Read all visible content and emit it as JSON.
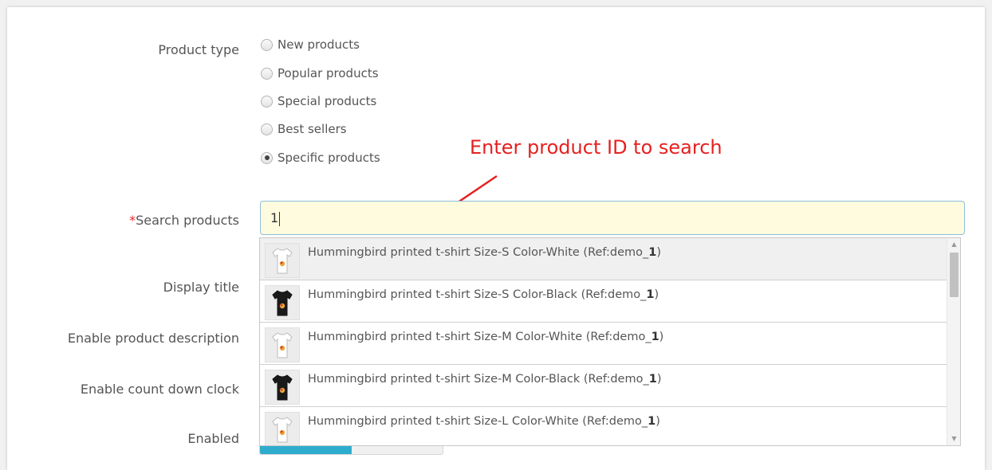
{
  "form": {
    "product_type_label": "Product type",
    "product_type_options": [
      "New products",
      "Popular products",
      "Special products",
      "Best sellers",
      "Specific products"
    ],
    "product_type_selected": "Specific products",
    "search_required_mark": "*",
    "search_label": "Search products",
    "search_value": "1",
    "display_title_label": "Display title",
    "enable_description_label": "Enable product description",
    "enable_countdown_label": "Enable count down clock",
    "enabled_label": "Enabled"
  },
  "annotation": {
    "text": "Enter product ID to search",
    "color": "#e62020"
  },
  "results": [
    {
      "prefix": "Hummingbird printed t-shirt Size-S Color-White (Ref:demo_",
      "match": "1",
      "suffix": ")",
      "shirt_color": "white"
    },
    {
      "prefix": "Hummingbird printed t-shirt Size-S Color-Black (Ref:demo_",
      "match": "1",
      "suffix": ")",
      "shirt_color": "black"
    },
    {
      "prefix": "Hummingbird printed t-shirt Size-M Color-White (Ref:demo_",
      "match": "1",
      "suffix": ")",
      "shirt_color": "white"
    },
    {
      "prefix": "Hummingbird printed t-shirt Size-M Color-Black (Ref:demo_",
      "match": "1",
      "suffix": ")",
      "shirt_color": "black"
    },
    {
      "prefix": "Hummingbird printed t-shirt Size-L Color-White (Ref:demo_",
      "match": "1",
      "suffix": ")",
      "shirt_color": "white"
    }
  ],
  "colors": {
    "input_bg": "#fffbde",
    "input_border": "#8dbdde",
    "toggle_on": "#2eacce",
    "required": "#e3272a"
  },
  "icons": {
    "scroll_up": "scroll-up-arrow-icon",
    "scroll_down": "scroll-down-arrow-icon",
    "thumbnail": "tshirt-icon"
  }
}
